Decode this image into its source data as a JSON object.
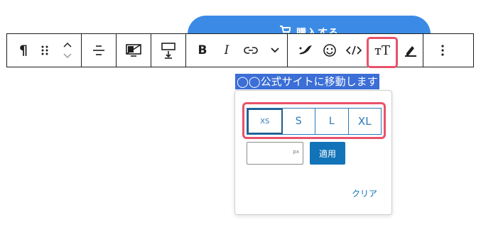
{
  "buy_button": {
    "label": "購入する",
    "icon": "cart-icon"
  },
  "toolbar": {
    "paragraph_glyph": "¶",
    "bold_label": "B",
    "italic_label": "I",
    "text_size_label": "тT"
  },
  "selected_text": "◯◯公式サイトに移動します",
  "popover": {
    "sizes": [
      "XS",
      "S",
      "L",
      "XL"
    ],
    "px_unit": "px",
    "px_value": "",
    "apply_label": "適用",
    "clear_label": "クリア"
  },
  "colors": {
    "accent_blue": "#1273b9",
    "button_blue": "#3b8be6",
    "highlight_red": "#e8526a",
    "selection_blue": "#3b6ed6"
  }
}
